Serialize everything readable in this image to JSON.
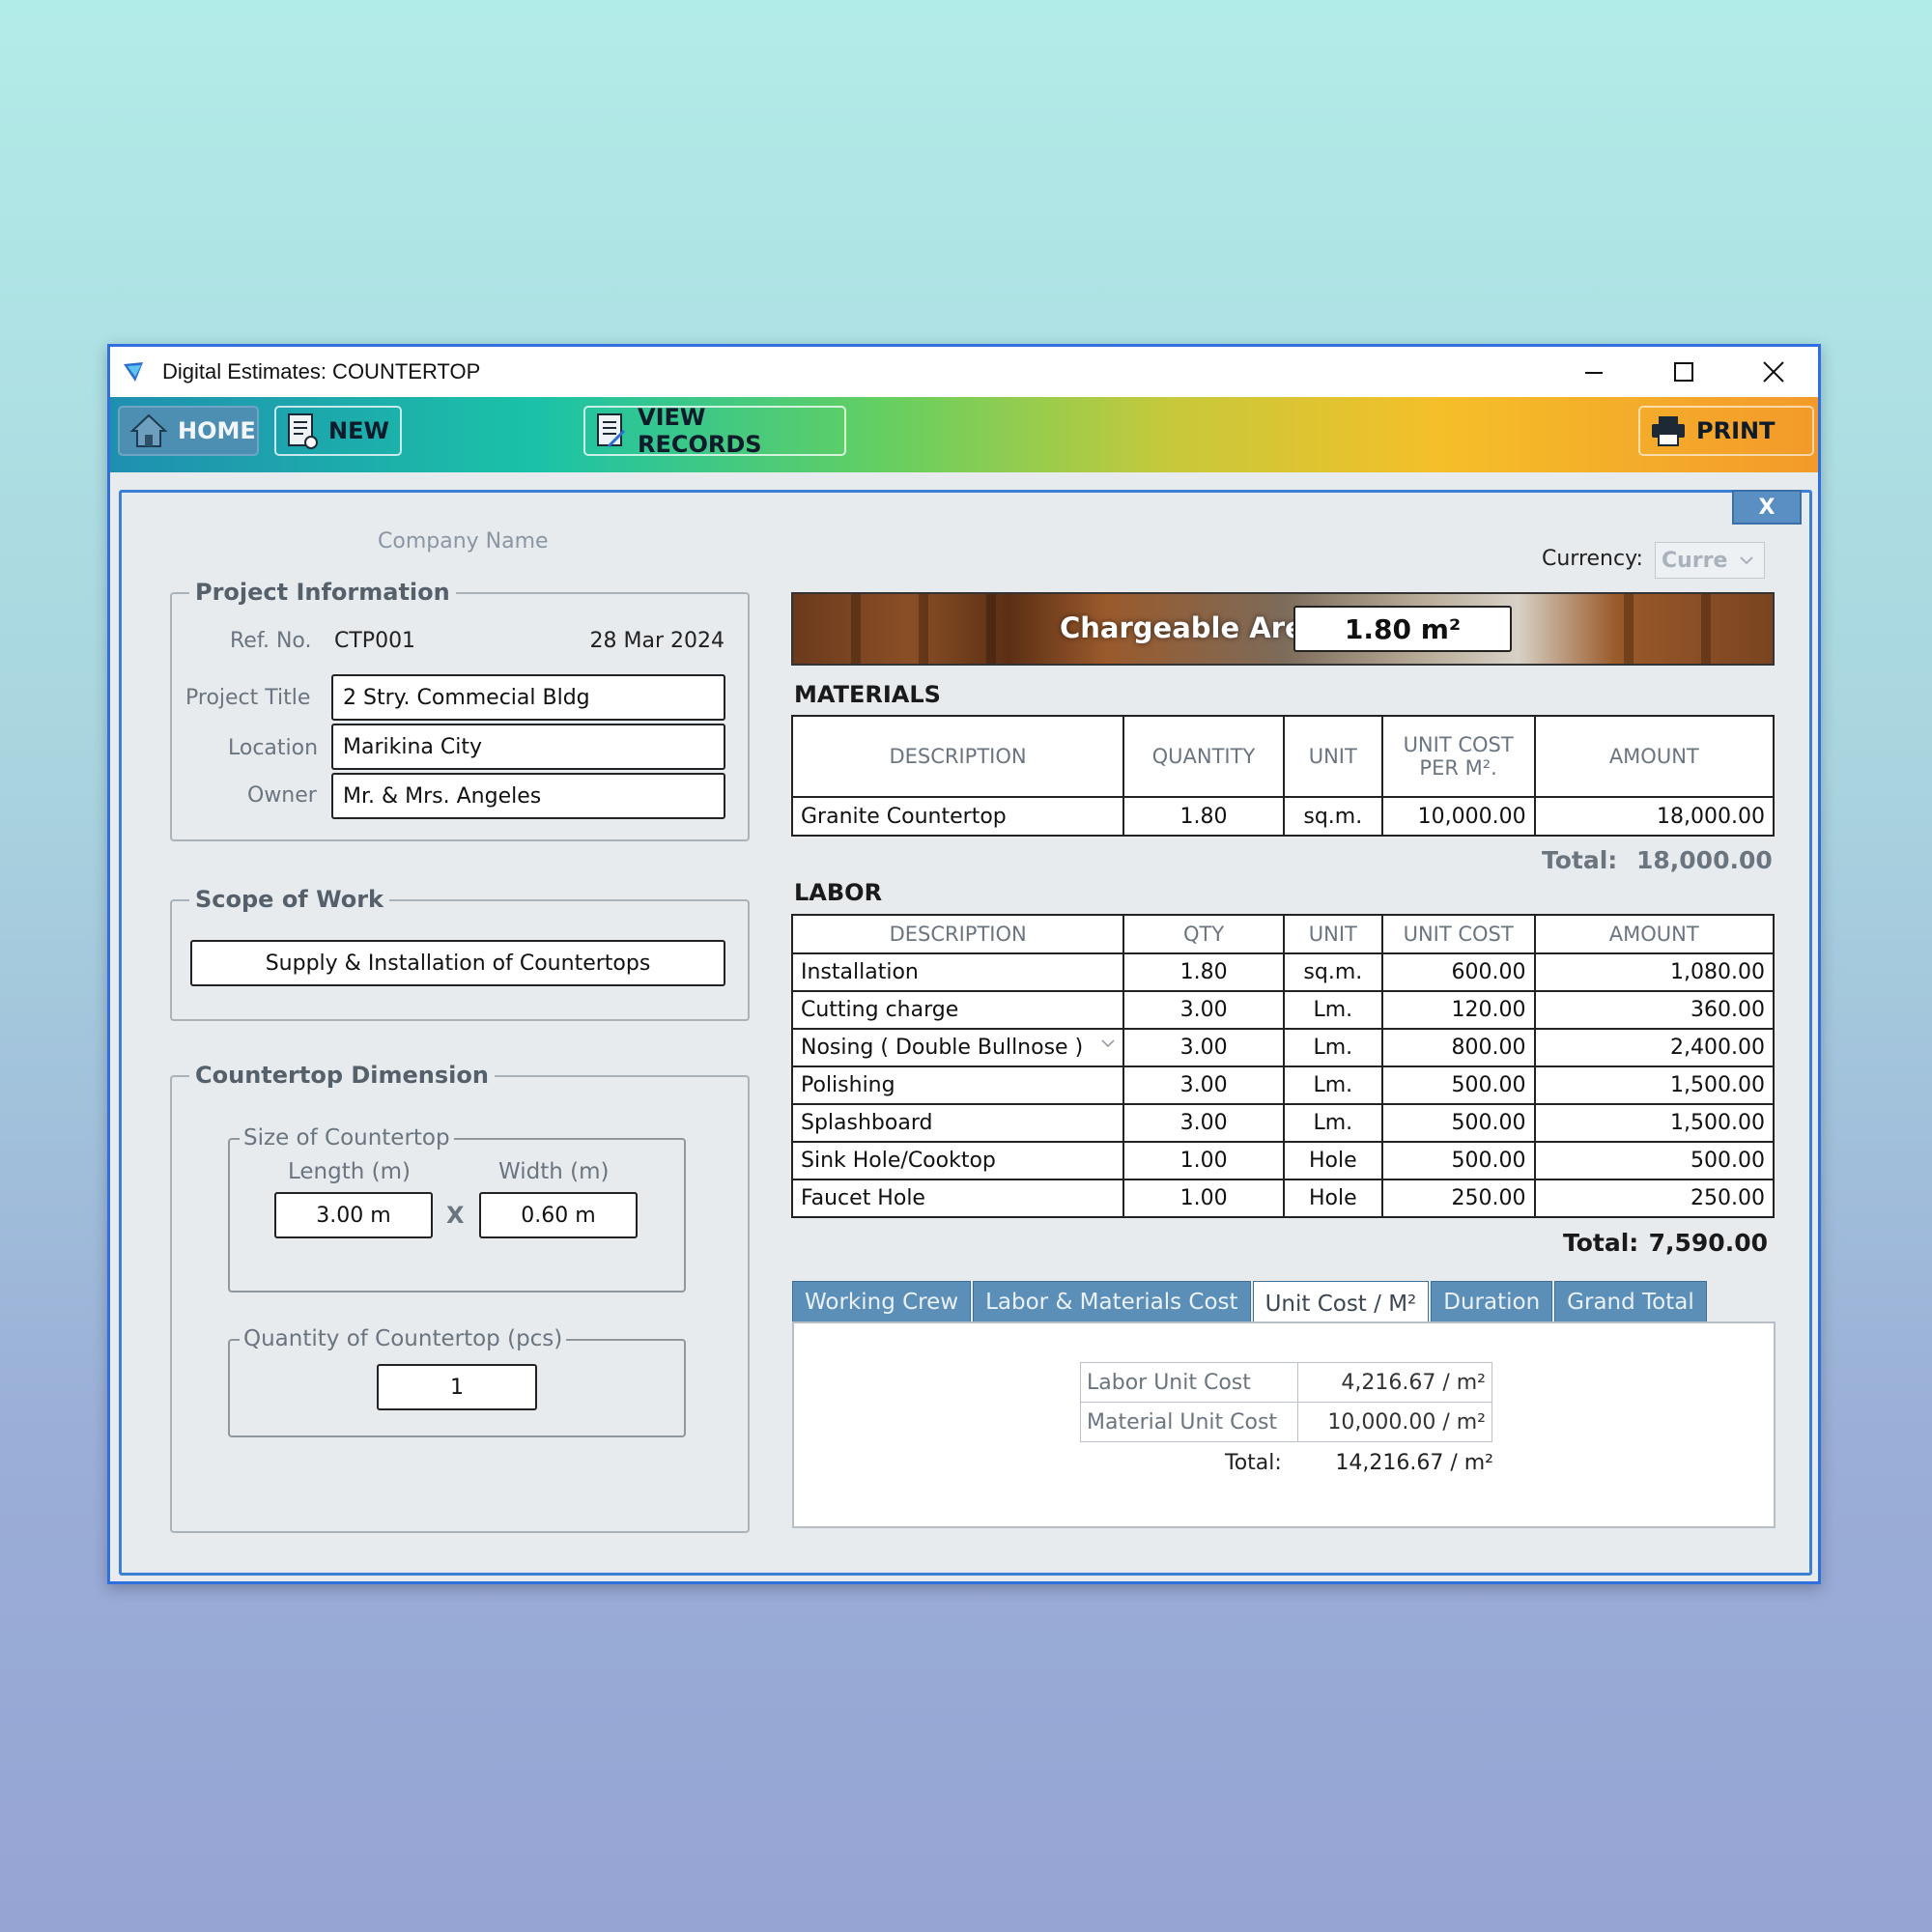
{
  "window": {
    "title": "Digital Estimates: COUNTERTOP"
  },
  "toolbar": {
    "home": "HOME",
    "new": "NEW",
    "view_records": "VIEW RECORDS",
    "print": "PRINT"
  },
  "panel": {
    "close": "X",
    "company_name": "Company Name"
  },
  "project": {
    "legend": "Project Information",
    "ref_label": "Ref. No.",
    "ref_value": "CTP001",
    "date": "28 Mar 2024",
    "title_label": "Project Title",
    "title_value": "2 Stry. Commecial Bldg",
    "location_label": "Location",
    "location_value": "Marikina City",
    "owner_label": "Owner",
    "owner_value": "Mr. & Mrs. Angeles"
  },
  "scope": {
    "legend": "Scope of Work",
    "value": "Supply & Installation of Countertops"
  },
  "dimension": {
    "legend": "Countertop Dimension",
    "size_legend": "Size of Countertop",
    "length_label": "Length (m)",
    "width_label": "Width (m)",
    "length_value": "3.00 m",
    "width_value": "0.60 m",
    "times": "X",
    "qty_legend": "Quantity of Countertop (pcs)",
    "qty_value": "1"
  },
  "currency": {
    "label": "Currency:",
    "selected": "Curre"
  },
  "chargeable": {
    "label": "Chargeable Area",
    "value": "1.80 m²"
  },
  "materials": {
    "title": "MATERIALS",
    "headers": [
      "DESCRIPTION",
      "QUANTITY",
      "UNIT",
      "UNIT COST PER M².",
      "AMOUNT"
    ],
    "header_unit_cost_1": "UNIT COST",
    "header_unit_cost_2": "PER M².",
    "rows": [
      [
        "Granite Countertop",
        "1.80",
        "sq.m.",
        "10,000.00",
        "18,000.00"
      ]
    ],
    "total_label": "Total:",
    "total_value": "18,000.00"
  },
  "labor": {
    "title": "LABOR",
    "headers": [
      "DESCRIPTION",
      "QTY",
      "UNIT",
      "UNIT COST",
      "AMOUNT"
    ],
    "rows": [
      [
        "Installation",
        "1.80",
        "sq.m.",
        "600.00",
        "1,080.00"
      ],
      [
        "Cutting charge",
        "3.00",
        "Lm.",
        "120.00",
        "360.00"
      ],
      [
        "Nosing ( Double Bullnose )",
        "3.00",
        "Lm.",
        "800.00",
        "2,400.00"
      ],
      [
        "Polishing",
        "3.00",
        "Lm.",
        "500.00",
        "1,500.00"
      ],
      [
        "Splashboard",
        "3.00",
        "Lm.",
        "500.00",
        "1,500.00"
      ],
      [
        "Sink Hole/Cooktop",
        "1.00",
        "Hole",
        "500.00",
        "500.00"
      ],
      [
        "Faucet Hole",
        "1.00",
        "Hole",
        "250.00",
        "250.00"
      ]
    ],
    "total_label": "Total:",
    "total_value": "7,590.00"
  },
  "tabs": [
    "Working Crew",
    "Labor & Materials Cost",
    "Unit Cost / M²",
    "Duration",
    "Grand Total"
  ],
  "active_tab": 2,
  "unit_cost": {
    "labor_label": "Labor Unit Cost",
    "labor_value": "4,216.67 / m²",
    "material_label": "Material Unit Cost",
    "material_value": "10,000.00 / m²",
    "total_label": "Total:",
    "total_value": "14,216.67 / m²"
  }
}
